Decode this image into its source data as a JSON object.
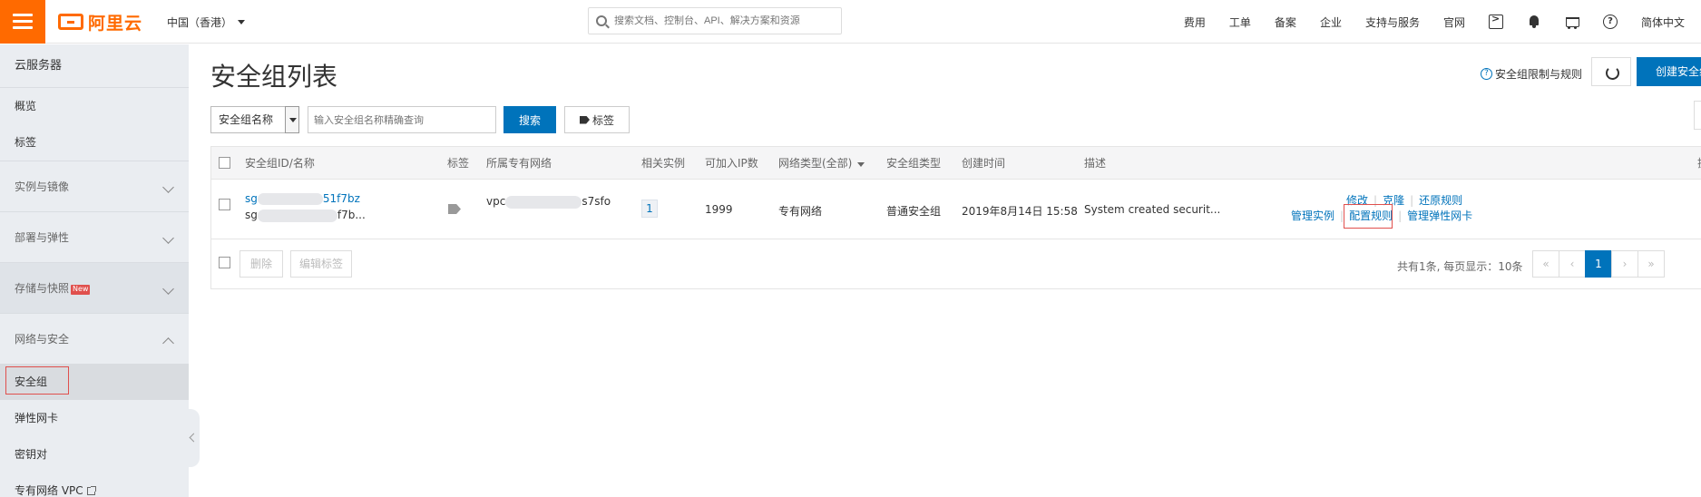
{
  "topbar": {
    "logo_text": "阿里云",
    "region": "中国（香港）",
    "search_placeholder": "搜索文档、控制台、API、解决方案和资源",
    "nav": [
      "费用",
      "工单",
      "备案",
      "企业",
      "支持与服务",
      "官网"
    ],
    "language": "简体中文"
  },
  "sidebar": {
    "title": "云服务器",
    "items_top": [
      "概览",
      "标签"
    ],
    "groups": [
      {
        "label": "实例与镜像",
        "expanded": false
      },
      {
        "label": "部署与弹性",
        "expanded": false
      },
      {
        "label": "存储与快照",
        "badge": "New",
        "expanded": false
      },
      {
        "label": "网络与安全",
        "expanded": true
      }
    ],
    "sub_items": [
      "安全组",
      "弹性网卡",
      "密钥对",
      "专有网络 VPC"
    ]
  },
  "main": {
    "title": "安全组列表",
    "limit_link": "安全组限制与规则",
    "create_button": "创建安全组",
    "filter_select": "安全组名称",
    "filter_placeholder": "输入安全组名称精确查询",
    "search_button": "搜索",
    "tag_button": "标签"
  },
  "table": {
    "headers": [
      "安全组ID/名称",
      "标签",
      "所属专有网络",
      "相关实例",
      "可加入IP数",
      "网络类型(全部)",
      "安全组类型",
      "创建时间",
      "描述",
      "操"
    ],
    "rows": [
      {
        "id_prefix": "sg",
        "id_suffix": "51f7bz",
        "name_prefix": "sg",
        "name_suffix": "f7b...",
        "vpc_prefix": "vpc",
        "vpc_suffix": "s7sfo",
        "instances": "1",
        "ip_count": "1999",
        "network_type": "专有网络",
        "group_type": "普通安全组",
        "created": "2019年8月14日 15:58",
        "description": "System created securit...",
        "actions_row1": [
          "修改",
          "克隆",
          "还原规则"
        ],
        "actions_row2": [
          "管理实例",
          "配置规则",
          "管理弹性网卡"
        ]
      }
    ],
    "footer_buttons": [
      "删除",
      "编辑标签"
    ],
    "total_text": "共有1条, 每页显示：10条",
    "pager": [
      "«",
      "‹",
      "1",
      "›",
      "»"
    ]
  },
  "colors": {
    "brand": "#ff6a00",
    "primary": "#0073bb",
    "highlight": "#e0504d"
  }
}
